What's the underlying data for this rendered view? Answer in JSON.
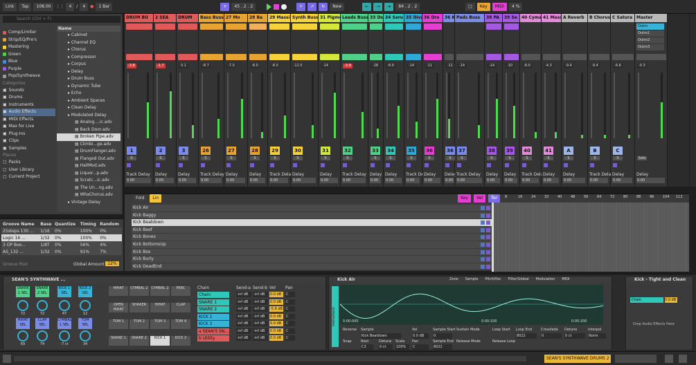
{
  "transport": {
    "link": "Link",
    "tap": "Tap",
    "tempo": "108.00",
    "sig_num": "4",
    "sig_den": "4",
    "quant": "1 Bar",
    "position": "45 . 2 . 2",
    "new": "New",
    "loop_start": "84 . 2 . 2",
    "key": "Key",
    "midi": "MIDI",
    "cpu": "4 %"
  },
  "browser": {
    "search_placeholder": "Search (Ctrl + F)",
    "collections": [
      {
        "label": "Comp/Limiter",
        "color": "#e05a5a"
      },
      {
        "label": "Strip/EQ/Pre's",
        "color": "#e8a430"
      },
      {
        "label": "Mastering",
        "color": "#f6d23a"
      },
      {
        "label": "Green",
        "color": "#4fd14f"
      },
      {
        "label": "Blue",
        "color": "#3a8fe8"
      },
      {
        "label": "Purple",
        "color": "#a45ae0"
      },
      {
        "label": "Pop/Synthwave",
        "color": "#999999"
      }
    ],
    "categories_label": "Categories",
    "categories": [
      "Sounds",
      "Drums",
      "Instruments",
      "Audio Effects",
      "MIDI Effects",
      "Max for Live",
      "Plug-Ins",
      "Clips",
      "Samples"
    ],
    "places_label": "Places",
    "places": [
      "Packs",
      "User Library",
      "Current Project"
    ],
    "list_header": "Name",
    "files": [
      {
        "label": "Cabinet",
        "type": "folder"
      },
      {
        "label": "Channel EQ",
        "type": "folder"
      },
      {
        "label": "Chorus",
        "type": "folder"
      },
      {
        "label": "Compressor",
        "type": "folder"
      },
      {
        "label": "Corpus",
        "type": "folder"
      },
      {
        "label": "Delay",
        "type": "folder"
      },
      {
        "label": "Drum Buss",
        "type": "folder"
      },
      {
        "label": "Dynamic Tube",
        "type": "folder"
      },
      {
        "label": "Echo",
        "type": "folder"
      },
      {
        "label": "Ambient Spaces",
        "type": "folder"
      },
      {
        "label": "Clean Delay",
        "type": "folder"
      },
      {
        "label": "Modulated Delay",
        "type": "folder"
      },
      {
        "label": "Analog....ic.adv",
        "type": "file"
      },
      {
        "label": "Back Door.adv",
        "type": "file"
      },
      {
        "label": "Broken Pipe.adv",
        "type": "file",
        "selected": true
      },
      {
        "label": "Climbi...ge.adv",
        "type": "file"
      },
      {
        "label": "DrumFlanger.adv",
        "type": "file"
      },
      {
        "label": "Flanged Out.adv",
        "type": "file"
      },
      {
        "label": "HallMod.adv",
        "type": "file"
      },
      {
        "label": "Liquor...p.adv",
        "type": "file"
      },
      {
        "label": "Scratc...ic.adv",
        "type": "file"
      },
      {
        "label": "The Un...ng.adv",
        "type": "file"
      },
      {
        "label": "WhaChorus.adv",
        "type": "file"
      },
      {
        "label": "Vintage Delay",
        "type": "folder"
      }
    ]
  },
  "groove": {
    "headers": [
      "Groove Name",
      "Base",
      "Quantize",
      "Timing",
      "Random"
    ],
    "rows": [
      {
        "name": "25steps 130 ...",
        "base": "1/16",
        "quantize": "0%",
        "timing": "100%",
        "random": "0%"
      },
      {
        "name": "Logic 16 ...",
        "base": "1/32",
        "quantize": "0%",
        "timing": "100%",
        "random": "0%",
        "selected": true
      },
      {
        "name": "3 OP Boo...",
        "base": "1/8T",
        "quantize": "0%",
        "timing": "56%",
        "random": "4%"
      },
      {
        "name": "AS_132 ...",
        "base": "1/32",
        "quantize": "0%",
        "timing": "91%",
        "random": "7%"
      }
    ],
    "pool_label": "Groove Pool",
    "global_amount_label": "Global Amount",
    "global_amount": "12%"
  },
  "tracks": [
    {
      "name": "DRUM BU",
      "color": "#e05a5a",
      "num": "1",
      "vol": "-3.8",
      "numcolor": "#7a8ce8",
      "level": 0.55,
      "clips": [
        "#e05a5a"
      ]
    },
    {
      "name": "2 SEA",
      "color": "#e05a5a",
      "num": "2",
      "vol": "-1.7",
      "numcolor": "#7a8ce8",
      "level": 0.72,
      "clips": [
        "#e05a5a"
      ]
    },
    {
      "name": "DRUM",
      "color": "#e05a5a",
      "num": "3",
      "vol": "0.1",
      "numcolor": "#7a8ce8",
      "level": 0.2,
      "clips": [
        "#e05a5a"
      ]
    },
    {
      "name": "Bass Buss",
      "color": "#e8a430",
      "num": "26",
      "vol": "-8.7",
      "numcolor": "#e8a430",
      "level": 0.3,
      "clips": [
        "#e8a430"
      ]
    },
    {
      "name": "27 Mo",
      "color": "#e8a430",
      "num": "27",
      "vol": "-7.0",
      "numcolor": "#e8a430",
      "level": 0.6,
      "clips": [
        "#e8a430"
      ]
    },
    {
      "name": "28 Ba",
      "color": "#e8a430",
      "num": "28",
      "vol": "-8.0",
      "numcolor": "#e8a430",
      "level": 0.1,
      "clips": [
        "#f0b060"
      ]
    },
    {
      "name": "29 Massi",
      "color": "#f6d23a",
      "num": "29",
      "vol": "-8.0",
      "numcolor": "#f6d23a",
      "level": 0.35,
      "clips": [
        "#f6d23a"
      ]
    },
    {
      "name": "Synth Buss",
      "color": "#f6d23a",
      "num": "30",
      "vol": "-12.0",
      "numcolor": "#f6d23a",
      "level": 0.2,
      "clips": [
        "#f6d23a"
      ]
    },
    {
      "name": "31 Pigme",
      "color": "#d4e83a",
      "num": "31",
      "vol": "-14",
      "numcolor": "#d4e83a",
      "level": 0.7,
      "clips": [
        "#d4e83a"
      ]
    },
    {
      "name": "Leads Buss",
      "color": "#4fd18a",
      "num": "32",
      "vol": "-3.9",
      "numcolor": "#4fd18a",
      "level": 0.4,
      "clips": [
        "#4fd18a"
      ]
    },
    {
      "name": "33 Ds",
      "color": "#4fd18a",
      "num": "33",
      "vol": "-28",
      "numcolor": "#4fd18a",
      "level": 0.15,
      "clips": [
        "#4fd18a"
      ]
    },
    {
      "name": "34 Seru",
      "color": "#2fc7b7",
      "num": "34",
      "vol": "-8.9",
      "numcolor": "#2fc7b7",
      "level": 0.5,
      "clips": [
        "#2fc7b7"
      ]
    },
    {
      "name": "35 Diva",
      "color": "#2fa7d7",
      "num": "35",
      "vol": "-14",
      "numcolor": "#2fa7d7",
      "level": 0.25,
      "clips": [
        "#2fa7d7"
      ]
    },
    {
      "name": "36 Dre",
      "color": "#e53fd1",
      "num": "36",
      "vol": "-11",
      "numcolor": "#e53fd1",
      "level": 0.6,
      "clips": [
        "#e53fd1"
      ]
    },
    {
      "name": "36 Konta",
      "color": "#7a8ce8",
      "num": "36",
      "vol": "-11",
      "numcolor": "#7a8ce8",
      "level": 0.3,
      "clips": []
    },
    {
      "name": "Pads Buss",
      "color": "#7a8ce8",
      "num": "37",
      "vol": "-14",
      "numcolor": "#7a8ce8",
      "level": 0.2,
      "clips": []
    },
    {
      "name": "38 PA",
      "color": "#a45ae0",
      "num": "38",
      "vol": "-14",
      "numcolor": "#a45ae0",
      "level": 0.6,
      "clips": [
        "#a45ae0"
      ]
    },
    {
      "name": "39 Se",
      "color": "#a45ae0",
      "num": "39",
      "vol": "-10",
      "numcolor": "#a45ae0",
      "level": 0.5,
      "clips": [
        "#a45ae0"
      ]
    },
    {
      "name": "40 Cyma",
      "color": "#e38ad8",
      "num": "40",
      "vol": "-8.0",
      "numcolor": "#e38ad8",
      "level": 0.1,
      "clips": []
    },
    {
      "name": "41 Massi",
      "color": "#e38ad8",
      "num": "41",
      "vol": "-4.3",
      "numcolor": "#e38ad8",
      "level": 0.1,
      "clips": []
    },
    {
      "name": "A Reverb",
      "color": "#b8b8b8",
      "num": "A",
      "vol": "-9.4",
      "numcolor": "#9db5e8",
      "level": 0.05,
      "clips": []
    },
    {
      "name": "B Chorus",
      "color": "#b8b8b8",
      "num": "B",
      "vol": "-9.4",
      "numcolor": "#9db5e8",
      "level": 0.05,
      "clips": []
    },
    {
      "name": "C Satura",
      "color": "#b8b8b8",
      "num": "C",
      "vol": "-6.6",
      "numcolor": "#9db5e8",
      "level": 0.05,
      "clips": []
    },
    {
      "name": "Master",
      "color": "#b8b8b8",
      "num": "",
      "vol": "-0.3",
      "numcolor": "#bbbbbb",
      "level": 0.55,
      "clips": []
    }
  ],
  "master_routing": [
    "Outro",
    "Outro1",
    "Outro2",
    "Outro3"
  ],
  "track_delay_label": "Track Delay",
  "delay_label": "Delay",
  "delay_value": "0.00",
  "delay_unit": "ms",
  "smp_label": "Smp",
  "drums": {
    "fold_label": "Fold",
    "lin_label": "Lin",
    "key_label": "Key",
    "vel_label": "Vel",
    "sel_label": "Sel",
    "rows": [
      "Kick Air",
      "Kick Baggy",
      "Kick Beatdown",
      "Kick Beef",
      "Kick Bones",
      "Kick BottomsUp",
      "Kick Box",
      "Kick Burly",
      "Kick DeadEnd"
    ],
    "selected_index": 2,
    "ruler": [
      "0",
      "8",
      "16",
      "24",
      "32",
      "40",
      "48",
      "56",
      "64",
      "72",
      "80",
      "88",
      "96",
      "104",
      "112"
    ]
  },
  "drum_rack": {
    "title": "SEAN'S SYNTHWAVE ...",
    "pads_top": [
      {
        "label": "SNARE 1 SEL",
        "color": "#4fd18a"
      },
      {
        "label": "SNARE 2 SEL",
        "color": "#4fd18a"
      },
      {
        "label": "KICK 1 SEL",
        "color": "#37b3d8"
      },
      {
        "label": "KICK 2 SEL",
        "color": "#37b3d8"
      }
    ],
    "pads_bottom": [
      {
        "label": "HIHAT SEL",
        "color": "#7a8ce8"
      },
      {
        "label": "CLAP SEL",
        "color": "#7a8ce8"
      },
      {
        "label": "CYMBAL 1 SEL",
        "color": "#7a8ce8"
      },
      {
        "label": "TOM SEL",
        "color": "#7a8ce8"
      }
    ],
    "knob_vals_top": [
      "72",
      "72",
      "47",
      "12"
    ],
    "knob_vals_bottom": [
      "69",
      "74",
      "-7 ct",
      "34"
    ],
    "grid": [
      "HIHAT",
      "CYMBAL 2",
      "CYMBAL 2",
      "PERC",
      "OPEN HIHAT",
      "SHAKER",
      "HIHAT",
      "CLAP",
      "TOM 1",
      "TOM 2",
      "TOM 3",
      "TOM 4",
      "SNARE 1",
      "SNARE 2",
      "KICK 1",
      "KICK 2"
    ],
    "chain_header": "Chain",
    "send_a_header": "Send-a",
    "send_b_header": "Send-b",
    "vol_header": "Vol",
    "pan_header": "Pan",
    "chains": [
      {
        "name": "Chain",
        "color": "#2fc7b7",
        "send_a": "-inf dB",
        "send_b": "-inf dB",
        "vol": "0.0 dB",
        "pan": "C"
      },
      {
        "name": "SNARE 1",
        "color": "#2fc7b7",
        "send_a": "-inf dB",
        "send_b": "-inf dB",
        "vol": "0.0 dB",
        "pan": "C"
      },
      {
        "name": "SNARE 2",
        "color": "#2fc7b7",
        "send_a": "-inf dB",
        "send_b": "-inf dB",
        "vol": "-5.6 dB",
        "pan": "C"
      },
      {
        "name": "KICK 1",
        "color": "#37b3d8",
        "send_a": "-inf dB",
        "send_b": "-inf dB",
        "vol": "0.0 dB",
        "pan": "C"
      },
      {
        "name": "KICK 2",
        "color": "#37b3d8",
        "send_a": "-inf dB",
        "send_b": "-inf dB",
        "vol": "0.0 dB",
        "pan": "C"
      },
      {
        "name": "a SEAN'S SN...",
        "color": "#e05a5a",
        "send_a": "-inf dB",
        "send_b": "-inf dB",
        "vol": "0.0 dB",
        "pan": "C"
      },
      {
        "name": "b Utility",
        "color": "#e05a5a",
        "send_a": "-inf dB",
        "send_b": "-inf dB",
        "vol": "0.0 dB",
        "pan": "C"
      }
    ]
  },
  "sampler": {
    "title": "Kick Air",
    "tabs": [
      "Zone",
      "Sample",
      "Pitch/Osc",
      "Filter/Global",
      "Modulation",
      "MIDI"
    ],
    "time_start": "0:00:000",
    "time_mid": "0:00:100",
    "time_end": "0:00:200",
    "labels": [
      "Reverse",
      "Sample",
      "Vol",
      "Sample Start",
      "Sustain Mode",
      "Loop Start",
      "Loop End",
      "Crossfade",
      "Detune",
      "Interpol"
    ],
    "sample_name": "Kick Beatdown",
    "vol": "0.0 dB",
    "sample_start": "0",
    "loop_end": "8022",
    "crossfade": "0",
    "detune": "0 ct",
    "interpol": "Norm",
    "labels2": [
      "Snap",
      "Root",
      "Detune",
      "Scale",
      "Pan",
      "Sample End",
      "Release Mode",
      "Release Loop"
    ],
    "root": "C3",
    "detune2": "0 ct",
    "scale": "100%",
    "pan": "C",
    "sample_end": "8022",
    "vertical_label": "Instrument"
  },
  "right_device": {
    "title": "Kick - Tight and Clean",
    "chain": "Chain",
    "vol": "0.0 dB",
    "hint": "Drop Audio Effects Here"
  },
  "status": {
    "text": "SEAN'S SYNTHWAVE DRUMS 2"
  }
}
